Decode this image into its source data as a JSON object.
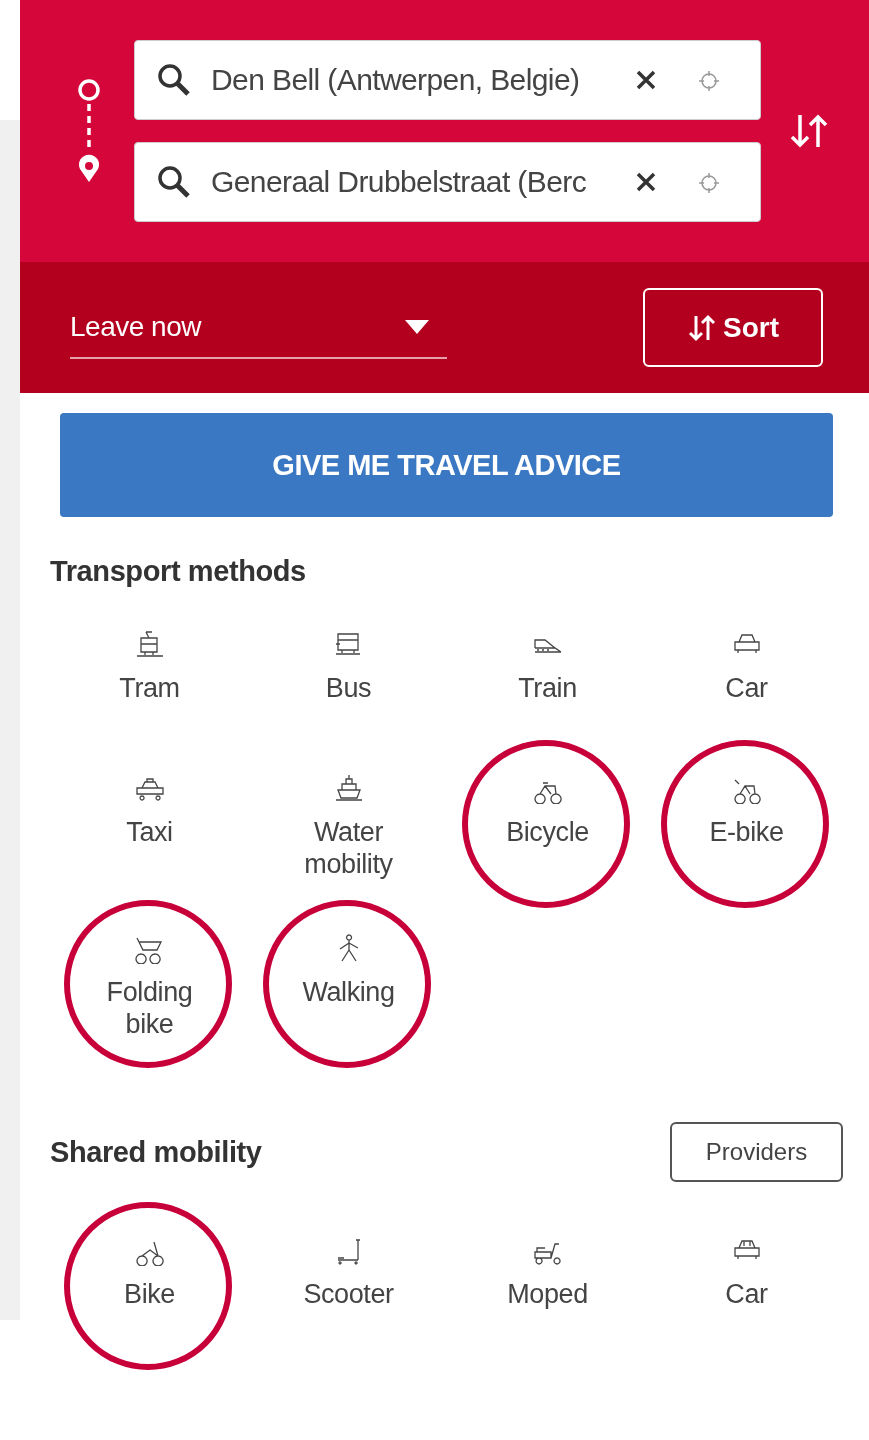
{
  "origin": {
    "value": "Den Bell (Antwerpen, Belgie)"
  },
  "destination": {
    "value": "Generaal Drubbelstraat (Berc"
  },
  "departure": {
    "value": "Leave now"
  },
  "sort_button": "Sort",
  "advice_button": "GIVE ME TRAVEL ADVICE",
  "transport_methods": {
    "title": "Transport methods",
    "items": [
      {
        "label": "Tram",
        "selected": false
      },
      {
        "label": "Bus",
        "selected": false
      },
      {
        "label": "Train",
        "selected": false
      },
      {
        "label": "Car",
        "selected": false
      },
      {
        "label": "Taxi",
        "selected": false
      },
      {
        "label": "Water mobility",
        "selected": false
      },
      {
        "label": "Bicycle",
        "selected": true
      },
      {
        "label": "E-bike",
        "selected": true
      },
      {
        "label": "Folding bike",
        "selected": true
      },
      {
        "label": "Walking",
        "selected": true
      }
    ]
  },
  "shared_mobility": {
    "title": "Shared mobility",
    "providers_button": "Providers",
    "items": [
      {
        "label": "Bike",
        "selected": true
      },
      {
        "label": "Scooter",
        "selected": false
      },
      {
        "label": "Moped",
        "selected": false
      },
      {
        "label": "Car",
        "selected": false
      }
    ]
  }
}
